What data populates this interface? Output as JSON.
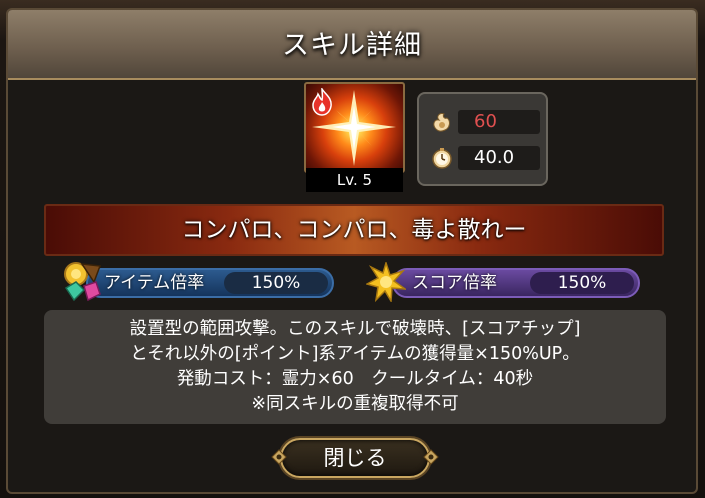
{
  "dialog": {
    "title": "スキル詳細",
    "close_label": "閉じる"
  },
  "skill": {
    "icon": "starburst-fire-icon",
    "level_text": "Lv. 5",
    "name": "コンパロ、コンパロ、毒よ散れー",
    "cost_value": "60",
    "cooldown_value": "40.0",
    "cost_color": "#e05050"
  },
  "rates": {
    "item_label": "アイテム倍率",
    "item_value": "150%",
    "score_label": "スコア倍率",
    "score_value": "150%"
  },
  "description": {
    "lines": [
      "設置型の範囲攻撃。このスキルで破壊時、[スコアチップ]",
      "とそれ以外の[ポイント]系アイテムの獲得量×150%UP。",
      "発動コスト：霊力×60　クールタイム：40秒",
      "※同スキルの重複取得不可"
    ]
  }
}
